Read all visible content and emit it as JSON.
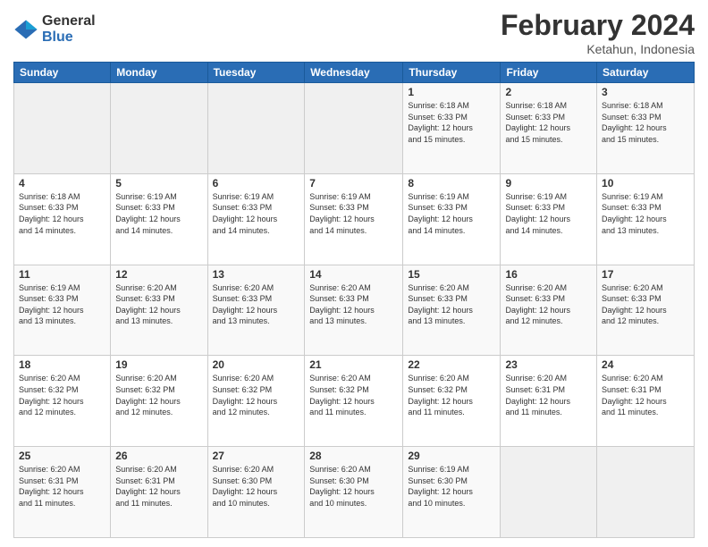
{
  "logo": {
    "general": "General",
    "blue": "Blue"
  },
  "header": {
    "title": "February 2024",
    "subtitle": "Ketahun, Indonesia"
  },
  "days_of_week": [
    "Sunday",
    "Monday",
    "Tuesday",
    "Wednesday",
    "Thursday",
    "Friday",
    "Saturday"
  ],
  "weeks": [
    [
      {
        "day": "",
        "info": ""
      },
      {
        "day": "",
        "info": ""
      },
      {
        "day": "",
        "info": ""
      },
      {
        "day": "",
        "info": ""
      },
      {
        "day": "1",
        "info": "Sunrise: 6:18 AM\nSunset: 6:33 PM\nDaylight: 12 hours\nand 15 minutes."
      },
      {
        "day": "2",
        "info": "Sunrise: 6:18 AM\nSunset: 6:33 PM\nDaylight: 12 hours\nand 15 minutes."
      },
      {
        "day": "3",
        "info": "Sunrise: 6:18 AM\nSunset: 6:33 PM\nDaylight: 12 hours\nand 15 minutes."
      }
    ],
    [
      {
        "day": "4",
        "info": "Sunrise: 6:18 AM\nSunset: 6:33 PM\nDaylight: 12 hours\nand 14 minutes."
      },
      {
        "day": "5",
        "info": "Sunrise: 6:19 AM\nSunset: 6:33 PM\nDaylight: 12 hours\nand 14 minutes."
      },
      {
        "day": "6",
        "info": "Sunrise: 6:19 AM\nSunset: 6:33 PM\nDaylight: 12 hours\nand 14 minutes."
      },
      {
        "day": "7",
        "info": "Sunrise: 6:19 AM\nSunset: 6:33 PM\nDaylight: 12 hours\nand 14 minutes."
      },
      {
        "day": "8",
        "info": "Sunrise: 6:19 AM\nSunset: 6:33 PM\nDaylight: 12 hours\nand 14 minutes."
      },
      {
        "day": "9",
        "info": "Sunrise: 6:19 AM\nSunset: 6:33 PM\nDaylight: 12 hours\nand 14 minutes."
      },
      {
        "day": "10",
        "info": "Sunrise: 6:19 AM\nSunset: 6:33 PM\nDaylight: 12 hours\nand 13 minutes."
      }
    ],
    [
      {
        "day": "11",
        "info": "Sunrise: 6:19 AM\nSunset: 6:33 PM\nDaylight: 12 hours\nand 13 minutes."
      },
      {
        "day": "12",
        "info": "Sunrise: 6:20 AM\nSunset: 6:33 PM\nDaylight: 12 hours\nand 13 minutes."
      },
      {
        "day": "13",
        "info": "Sunrise: 6:20 AM\nSunset: 6:33 PM\nDaylight: 12 hours\nand 13 minutes."
      },
      {
        "day": "14",
        "info": "Sunrise: 6:20 AM\nSunset: 6:33 PM\nDaylight: 12 hours\nand 13 minutes."
      },
      {
        "day": "15",
        "info": "Sunrise: 6:20 AM\nSunset: 6:33 PM\nDaylight: 12 hours\nand 13 minutes."
      },
      {
        "day": "16",
        "info": "Sunrise: 6:20 AM\nSunset: 6:33 PM\nDaylight: 12 hours\nand 12 minutes."
      },
      {
        "day": "17",
        "info": "Sunrise: 6:20 AM\nSunset: 6:33 PM\nDaylight: 12 hours\nand 12 minutes."
      }
    ],
    [
      {
        "day": "18",
        "info": "Sunrise: 6:20 AM\nSunset: 6:32 PM\nDaylight: 12 hours\nand 12 minutes."
      },
      {
        "day": "19",
        "info": "Sunrise: 6:20 AM\nSunset: 6:32 PM\nDaylight: 12 hours\nand 12 minutes."
      },
      {
        "day": "20",
        "info": "Sunrise: 6:20 AM\nSunset: 6:32 PM\nDaylight: 12 hours\nand 12 minutes."
      },
      {
        "day": "21",
        "info": "Sunrise: 6:20 AM\nSunset: 6:32 PM\nDaylight: 12 hours\nand 11 minutes."
      },
      {
        "day": "22",
        "info": "Sunrise: 6:20 AM\nSunset: 6:32 PM\nDaylight: 12 hours\nand 11 minutes."
      },
      {
        "day": "23",
        "info": "Sunrise: 6:20 AM\nSunset: 6:31 PM\nDaylight: 12 hours\nand 11 minutes."
      },
      {
        "day": "24",
        "info": "Sunrise: 6:20 AM\nSunset: 6:31 PM\nDaylight: 12 hours\nand 11 minutes."
      }
    ],
    [
      {
        "day": "25",
        "info": "Sunrise: 6:20 AM\nSunset: 6:31 PM\nDaylight: 12 hours\nand 11 minutes."
      },
      {
        "day": "26",
        "info": "Sunrise: 6:20 AM\nSunset: 6:31 PM\nDaylight: 12 hours\nand 11 minutes."
      },
      {
        "day": "27",
        "info": "Sunrise: 6:20 AM\nSunset: 6:30 PM\nDaylight: 12 hours\nand 10 minutes."
      },
      {
        "day": "28",
        "info": "Sunrise: 6:20 AM\nSunset: 6:30 PM\nDaylight: 12 hours\nand 10 minutes."
      },
      {
        "day": "29",
        "info": "Sunrise: 6:19 AM\nSunset: 6:30 PM\nDaylight: 12 hours\nand 10 minutes."
      },
      {
        "day": "",
        "info": ""
      },
      {
        "day": "",
        "info": ""
      }
    ]
  ]
}
